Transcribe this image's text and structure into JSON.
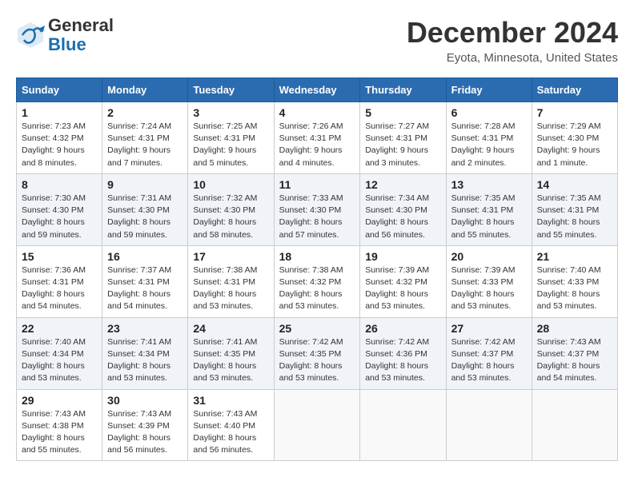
{
  "header": {
    "logo_line1": "General",
    "logo_line2": "Blue",
    "month": "December 2024",
    "location": "Eyota, Minnesota, United States"
  },
  "weekdays": [
    "Sunday",
    "Monday",
    "Tuesday",
    "Wednesday",
    "Thursday",
    "Friday",
    "Saturday"
  ],
  "weeks": [
    [
      {
        "day": "1",
        "sunrise": "Sunrise: 7:23 AM",
        "sunset": "Sunset: 4:32 PM",
        "daylight": "Daylight: 9 hours and 8 minutes."
      },
      {
        "day": "2",
        "sunrise": "Sunrise: 7:24 AM",
        "sunset": "Sunset: 4:31 PM",
        "daylight": "Daylight: 9 hours and 7 minutes."
      },
      {
        "day": "3",
        "sunrise": "Sunrise: 7:25 AM",
        "sunset": "Sunset: 4:31 PM",
        "daylight": "Daylight: 9 hours and 5 minutes."
      },
      {
        "day": "4",
        "sunrise": "Sunrise: 7:26 AM",
        "sunset": "Sunset: 4:31 PM",
        "daylight": "Daylight: 9 hours and 4 minutes."
      },
      {
        "day": "5",
        "sunrise": "Sunrise: 7:27 AM",
        "sunset": "Sunset: 4:31 PM",
        "daylight": "Daylight: 9 hours and 3 minutes."
      },
      {
        "day": "6",
        "sunrise": "Sunrise: 7:28 AM",
        "sunset": "Sunset: 4:31 PM",
        "daylight": "Daylight: 9 hours and 2 minutes."
      },
      {
        "day": "7",
        "sunrise": "Sunrise: 7:29 AM",
        "sunset": "Sunset: 4:30 PM",
        "daylight": "Daylight: 9 hours and 1 minute."
      }
    ],
    [
      {
        "day": "8",
        "sunrise": "Sunrise: 7:30 AM",
        "sunset": "Sunset: 4:30 PM",
        "daylight": "Daylight: 8 hours and 59 minutes."
      },
      {
        "day": "9",
        "sunrise": "Sunrise: 7:31 AM",
        "sunset": "Sunset: 4:30 PM",
        "daylight": "Daylight: 8 hours and 59 minutes."
      },
      {
        "day": "10",
        "sunrise": "Sunrise: 7:32 AM",
        "sunset": "Sunset: 4:30 PM",
        "daylight": "Daylight: 8 hours and 58 minutes."
      },
      {
        "day": "11",
        "sunrise": "Sunrise: 7:33 AM",
        "sunset": "Sunset: 4:30 PM",
        "daylight": "Daylight: 8 hours and 57 minutes."
      },
      {
        "day": "12",
        "sunrise": "Sunrise: 7:34 AM",
        "sunset": "Sunset: 4:30 PM",
        "daylight": "Daylight: 8 hours and 56 minutes."
      },
      {
        "day": "13",
        "sunrise": "Sunrise: 7:35 AM",
        "sunset": "Sunset: 4:31 PM",
        "daylight": "Daylight: 8 hours and 55 minutes."
      },
      {
        "day": "14",
        "sunrise": "Sunrise: 7:35 AM",
        "sunset": "Sunset: 4:31 PM",
        "daylight": "Daylight: 8 hours and 55 minutes."
      }
    ],
    [
      {
        "day": "15",
        "sunrise": "Sunrise: 7:36 AM",
        "sunset": "Sunset: 4:31 PM",
        "daylight": "Daylight: 8 hours and 54 minutes."
      },
      {
        "day": "16",
        "sunrise": "Sunrise: 7:37 AM",
        "sunset": "Sunset: 4:31 PM",
        "daylight": "Daylight: 8 hours and 54 minutes."
      },
      {
        "day": "17",
        "sunrise": "Sunrise: 7:38 AM",
        "sunset": "Sunset: 4:31 PM",
        "daylight": "Daylight: 8 hours and 53 minutes."
      },
      {
        "day": "18",
        "sunrise": "Sunrise: 7:38 AM",
        "sunset": "Sunset: 4:32 PM",
        "daylight": "Daylight: 8 hours and 53 minutes."
      },
      {
        "day": "19",
        "sunrise": "Sunrise: 7:39 AM",
        "sunset": "Sunset: 4:32 PM",
        "daylight": "Daylight: 8 hours and 53 minutes."
      },
      {
        "day": "20",
        "sunrise": "Sunrise: 7:39 AM",
        "sunset": "Sunset: 4:33 PM",
        "daylight": "Daylight: 8 hours and 53 minutes."
      },
      {
        "day": "21",
        "sunrise": "Sunrise: 7:40 AM",
        "sunset": "Sunset: 4:33 PM",
        "daylight": "Daylight: 8 hours and 53 minutes."
      }
    ],
    [
      {
        "day": "22",
        "sunrise": "Sunrise: 7:40 AM",
        "sunset": "Sunset: 4:34 PM",
        "daylight": "Daylight: 8 hours and 53 minutes."
      },
      {
        "day": "23",
        "sunrise": "Sunrise: 7:41 AM",
        "sunset": "Sunset: 4:34 PM",
        "daylight": "Daylight: 8 hours and 53 minutes."
      },
      {
        "day": "24",
        "sunrise": "Sunrise: 7:41 AM",
        "sunset": "Sunset: 4:35 PM",
        "daylight": "Daylight: 8 hours and 53 minutes."
      },
      {
        "day": "25",
        "sunrise": "Sunrise: 7:42 AM",
        "sunset": "Sunset: 4:35 PM",
        "daylight": "Daylight: 8 hours and 53 minutes."
      },
      {
        "day": "26",
        "sunrise": "Sunrise: 7:42 AM",
        "sunset": "Sunset: 4:36 PM",
        "daylight": "Daylight: 8 hours and 53 minutes."
      },
      {
        "day": "27",
        "sunrise": "Sunrise: 7:42 AM",
        "sunset": "Sunset: 4:37 PM",
        "daylight": "Daylight: 8 hours and 53 minutes."
      },
      {
        "day": "28",
        "sunrise": "Sunrise: 7:43 AM",
        "sunset": "Sunset: 4:37 PM",
        "daylight": "Daylight: 8 hours and 54 minutes."
      }
    ],
    [
      {
        "day": "29",
        "sunrise": "Sunrise: 7:43 AM",
        "sunset": "Sunset: 4:38 PM",
        "daylight": "Daylight: 8 hours and 55 minutes."
      },
      {
        "day": "30",
        "sunrise": "Sunrise: 7:43 AM",
        "sunset": "Sunset: 4:39 PM",
        "daylight": "Daylight: 8 hours and 56 minutes."
      },
      {
        "day": "31",
        "sunrise": "Sunrise: 7:43 AM",
        "sunset": "Sunset: 4:40 PM",
        "daylight": "Daylight: 8 hours and 56 minutes."
      },
      null,
      null,
      null,
      null
    ]
  ]
}
